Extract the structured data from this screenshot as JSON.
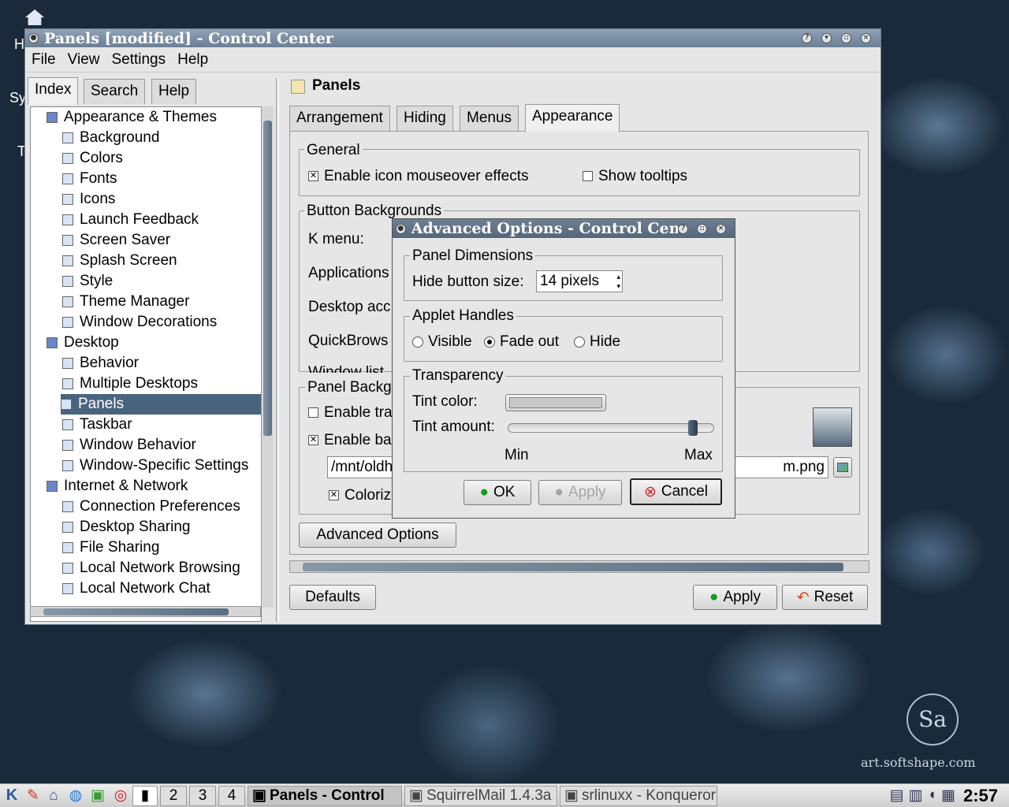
{
  "window": {
    "title": "Panels [modified] - Control Center",
    "menu": [
      "File",
      "View",
      "Settings",
      "Help"
    ]
  },
  "sidebar": {
    "tabs": [
      "Index",
      "Search",
      "Help"
    ],
    "items": [
      {
        "label": "Appearance & Themes",
        "level": 0,
        "icon": "appearance-icon"
      },
      {
        "label": "Background",
        "level": 1,
        "icon": "background-icon"
      },
      {
        "label": "Colors",
        "level": 1,
        "icon": "colors-icon"
      },
      {
        "label": "Fonts",
        "level": 1,
        "icon": "fonts-icon"
      },
      {
        "label": "Icons",
        "level": 1,
        "icon": "icons-icon"
      },
      {
        "label": "Launch Feedback",
        "level": 1,
        "icon": "launch-feedback-icon"
      },
      {
        "label": "Screen Saver",
        "level": 1,
        "icon": "screen-saver-icon"
      },
      {
        "label": "Splash Screen",
        "level": 1,
        "icon": "splash-screen-icon"
      },
      {
        "label": "Style",
        "level": 1,
        "icon": "style-icon"
      },
      {
        "label": "Theme Manager",
        "level": 1,
        "icon": "theme-manager-icon"
      },
      {
        "label": "Window Decorations",
        "level": 1,
        "icon": "window-decorations-icon"
      },
      {
        "label": "Desktop",
        "level": 0,
        "icon": "desktop-icon"
      },
      {
        "label": "Behavior",
        "level": 1,
        "icon": "behavior-icon"
      },
      {
        "label": "Multiple Desktops",
        "level": 1,
        "icon": "multiple-desktops-icon"
      },
      {
        "label": "Panels",
        "level": 1,
        "icon": "panels-icon",
        "selected": true
      },
      {
        "label": "Taskbar",
        "level": 1,
        "icon": "taskbar-icon"
      },
      {
        "label": "Window Behavior",
        "level": 1,
        "icon": "window-behavior-icon"
      },
      {
        "label": "Window-Specific Settings",
        "level": 1,
        "icon": "window-specific-icon"
      },
      {
        "label": "Internet & Network",
        "level": 0,
        "icon": "internet-icon"
      },
      {
        "label": "Connection Preferences",
        "level": 1,
        "icon": "connection-icon"
      },
      {
        "label": "Desktop Sharing",
        "level": 1,
        "icon": "desktop-sharing-icon"
      },
      {
        "label": "File Sharing",
        "level": 1,
        "icon": "file-sharing-icon"
      },
      {
        "label": "Local Network Browsing",
        "level": 1,
        "icon": "network-browsing-icon"
      },
      {
        "label": "Local Network Chat",
        "level": 1,
        "icon": "network-chat-icon"
      }
    ]
  },
  "panel": {
    "title": "Panels",
    "tabs": [
      "Arrangement",
      "Hiding",
      "Menus",
      "Appearance"
    ],
    "general": {
      "legend": "General",
      "enable_mouseover": "Enable icon mouseover effects",
      "show_tooltips": "Show tooltips"
    },
    "button_bg": {
      "legend": "Button Backgrounds",
      "k_menu": "K menu:",
      "applications": "Applications",
      "desktop_access": "Desktop acc",
      "quickbrowser": "QuickBrows",
      "window_list": "Window list"
    },
    "panel_bg": {
      "legend": "Panel Backg",
      "enable_transparency": "Enable tra",
      "enable_bg": "Enable ba",
      "path_start": "/mnt/oldh",
      "path_end": "m.png",
      "colorize": "Colorize"
    },
    "advanced_button": "Advanced Options",
    "defaults": "Defaults",
    "apply": "Apply",
    "reset": "Reset"
  },
  "dialog": {
    "title": "Advanced Options - Control Center",
    "dims": {
      "legend": "Panel Dimensions",
      "label": "Hide button size:",
      "value": "14 pixels"
    },
    "handles": {
      "legend": "Applet Handles",
      "visible": "Visible",
      "fade": "Fade out",
      "hide": "Hide"
    },
    "transparency": {
      "legend": "Transparency",
      "tint_color": "Tint color:",
      "tint_amount": "Tint amount:",
      "min": "Min",
      "max": "Max",
      "tint_level": 0.92
    },
    "ok": "OK",
    "apply": "Apply",
    "cancel": "Cancel"
  },
  "taskbar": {
    "desktops": [
      "2",
      "3",
      "4"
    ],
    "tasks": [
      "Panels - Control",
      "SquirrelMail 1.4.3a",
      "srlinuxx - Konqueror"
    ],
    "clock": "2:57"
  },
  "watermark": "art.softshape.com"
}
